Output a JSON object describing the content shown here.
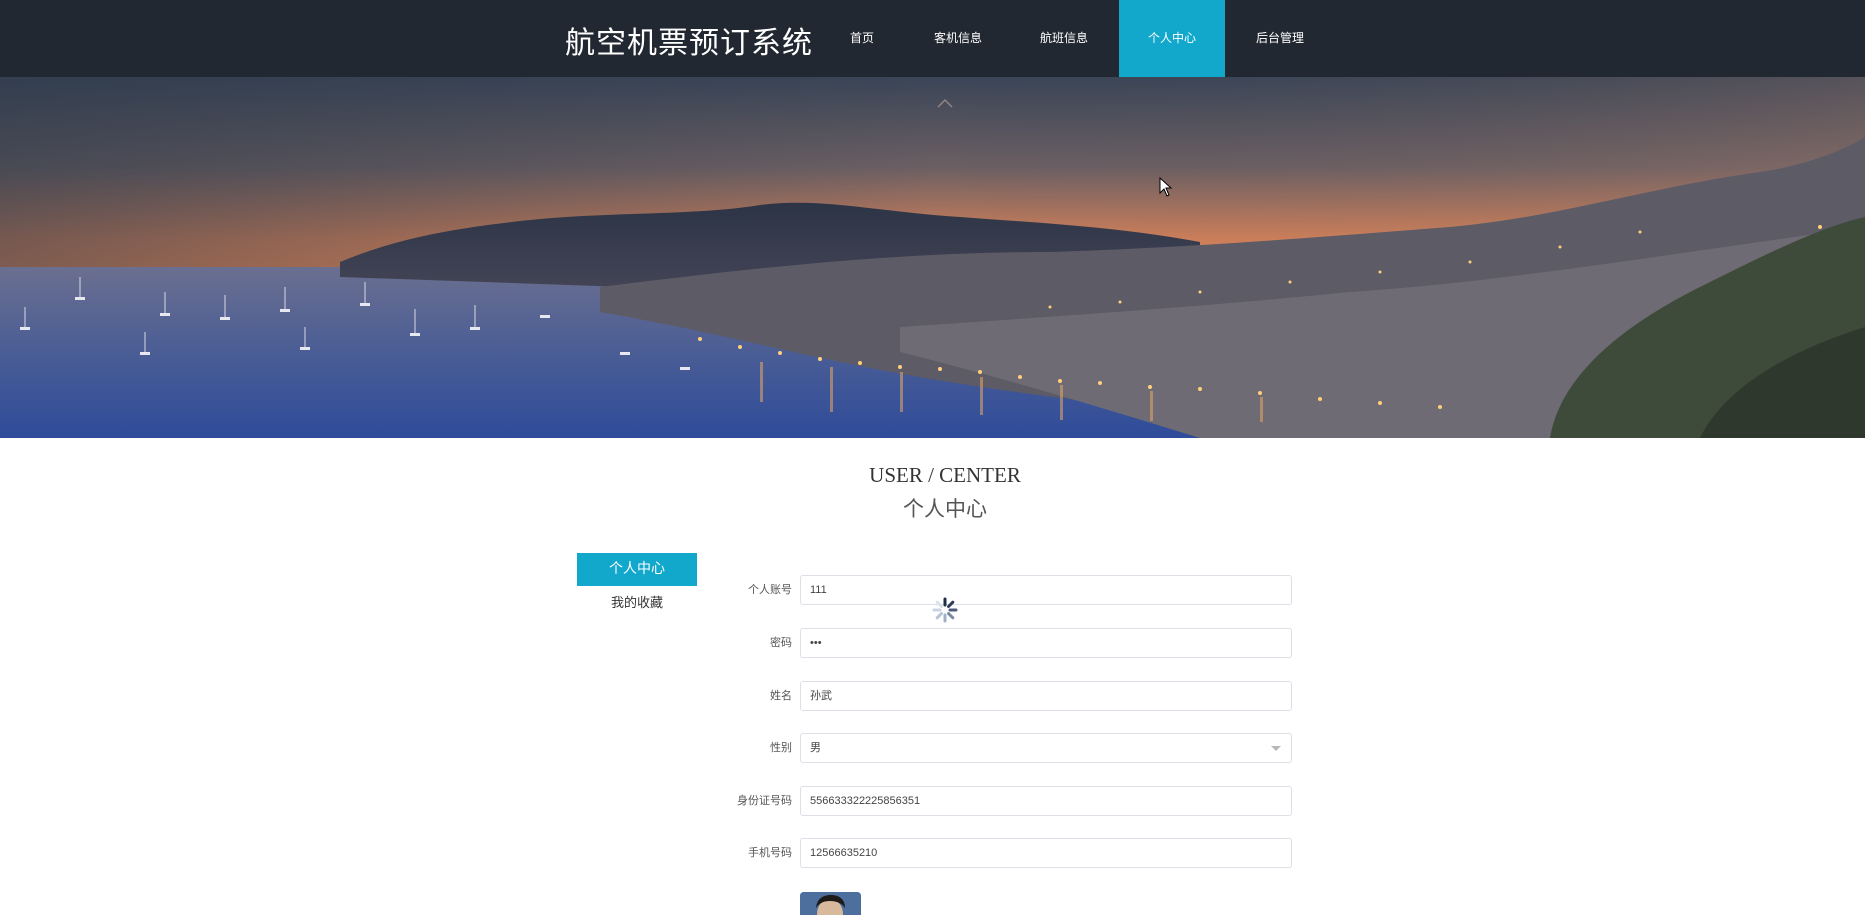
{
  "header": {
    "brand": "航空机票预订系统",
    "nav": [
      {
        "label": "首页",
        "active": false
      },
      {
        "label": "客机信息",
        "active": false
      },
      {
        "label": "航班信息",
        "active": false
      },
      {
        "label": "个人中心",
        "active": true
      },
      {
        "label": "后台管理",
        "active": false
      }
    ]
  },
  "section": {
    "title_en": "USER / CENTER",
    "title_cn": "个人中心"
  },
  "sidebar": {
    "items": [
      {
        "label": "个人中心",
        "active": true
      },
      {
        "label": "我的收藏",
        "active": false
      }
    ]
  },
  "form": {
    "account": {
      "label": "个人账号",
      "value": "111"
    },
    "password": {
      "label": "密码",
      "value": "•••"
    },
    "name": {
      "label": "姓名",
      "value": "孙武"
    },
    "gender": {
      "label": "性别",
      "value": "男"
    },
    "id_number": {
      "label": "身份证号码",
      "value": "556633322225856351"
    },
    "phone": {
      "label": "手机号码",
      "value": "12566635210"
    }
  },
  "colors": {
    "nav_bg": "#222831",
    "accent": "#11a8cc"
  },
  "icons": [
    "loading-spinner-icon",
    "mouse-cursor-icon",
    "chevron-down-icon"
  ]
}
